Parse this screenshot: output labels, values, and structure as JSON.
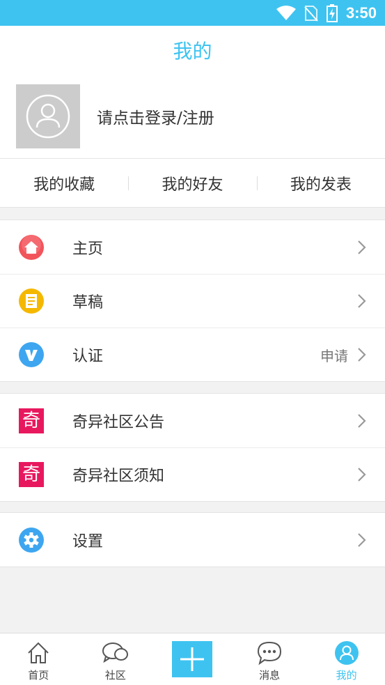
{
  "status_bar": {
    "time": "3:50"
  },
  "header": {
    "title": "我的"
  },
  "profile": {
    "login_text": "请点击登录/注册"
  },
  "quick_links": [
    {
      "label": "我的收藏"
    },
    {
      "label": "我的好友"
    },
    {
      "label": "我的发表"
    }
  ],
  "menu_group_1": [
    {
      "label": "主页",
      "icon": "home-icon",
      "color": "#f2545b"
    },
    {
      "label": "草稿",
      "icon": "draft-icon",
      "color": "#f5b800"
    },
    {
      "label": "认证",
      "icon": "verify-icon",
      "color": "#3ea6f0",
      "extra": "申请"
    }
  ],
  "menu_group_2": [
    {
      "label": "奇异社区公告",
      "icon_text": "奇",
      "color": "#e8185e"
    },
    {
      "label": "奇异社区须知",
      "icon_text": "奇",
      "color": "#e8185e"
    }
  ],
  "menu_group_3": [
    {
      "label": "设置",
      "icon": "settings-icon",
      "color": "#3ea6f0"
    }
  ],
  "tab_bar": [
    {
      "label": "首页",
      "icon": "home-outline-icon"
    },
    {
      "label": "社区",
      "icon": "chat-bubbles-icon"
    },
    {
      "label": "",
      "icon": "plus-icon"
    },
    {
      "label": "消息",
      "icon": "message-icon"
    },
    {
      "label": "我的",
      "icon": "user-icon",
      "active": true
    }
  ],
  "colors": {
    "accent": "#3ec3f0",
    "brand_red": "#e8185e"
  }
}
